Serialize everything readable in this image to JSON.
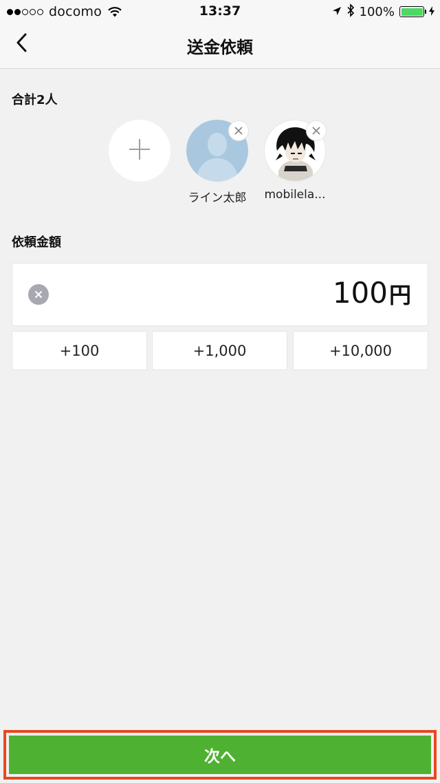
{
  "status_bar": {
    "carrier": "docomo",
    "time": "13:37",
    "battery": "100%",
    "signal_filled": 2,
    "signal_total": 5
  },
  "nav": {
    "title": "送金依頼",
    "back_icon": "chevron-left-icon"
  },
  "recipients_section": {
    "label": "合計2人",
    "add_icon": "plus-icon",
    "recipients": [
      {
        "name": "ライン太郎",
        "avatar": "default-person-avatar"
      },
      {
        "name": "mobilela...",
        "avatar": "anime-character-avatar"
      }
    ]
  },
  "amount_section": {
    "label": "依頼金額",
    "amount": "100",
    "unit": "円",
    "quick_adds": [
      "+100",
      "+1,000",
      "+10,000"
    ]
  },
  "next_button": {
    "label": "次へ"
  },
  "colors": {
    "accent_green": "#4fb131",
    "highlight_border": "#e8471e",
    "background": "#f1f1f1",
    "default_avatar_bg": "#a9c8df",
    "battery_green": "#4cd964"
  }
}
